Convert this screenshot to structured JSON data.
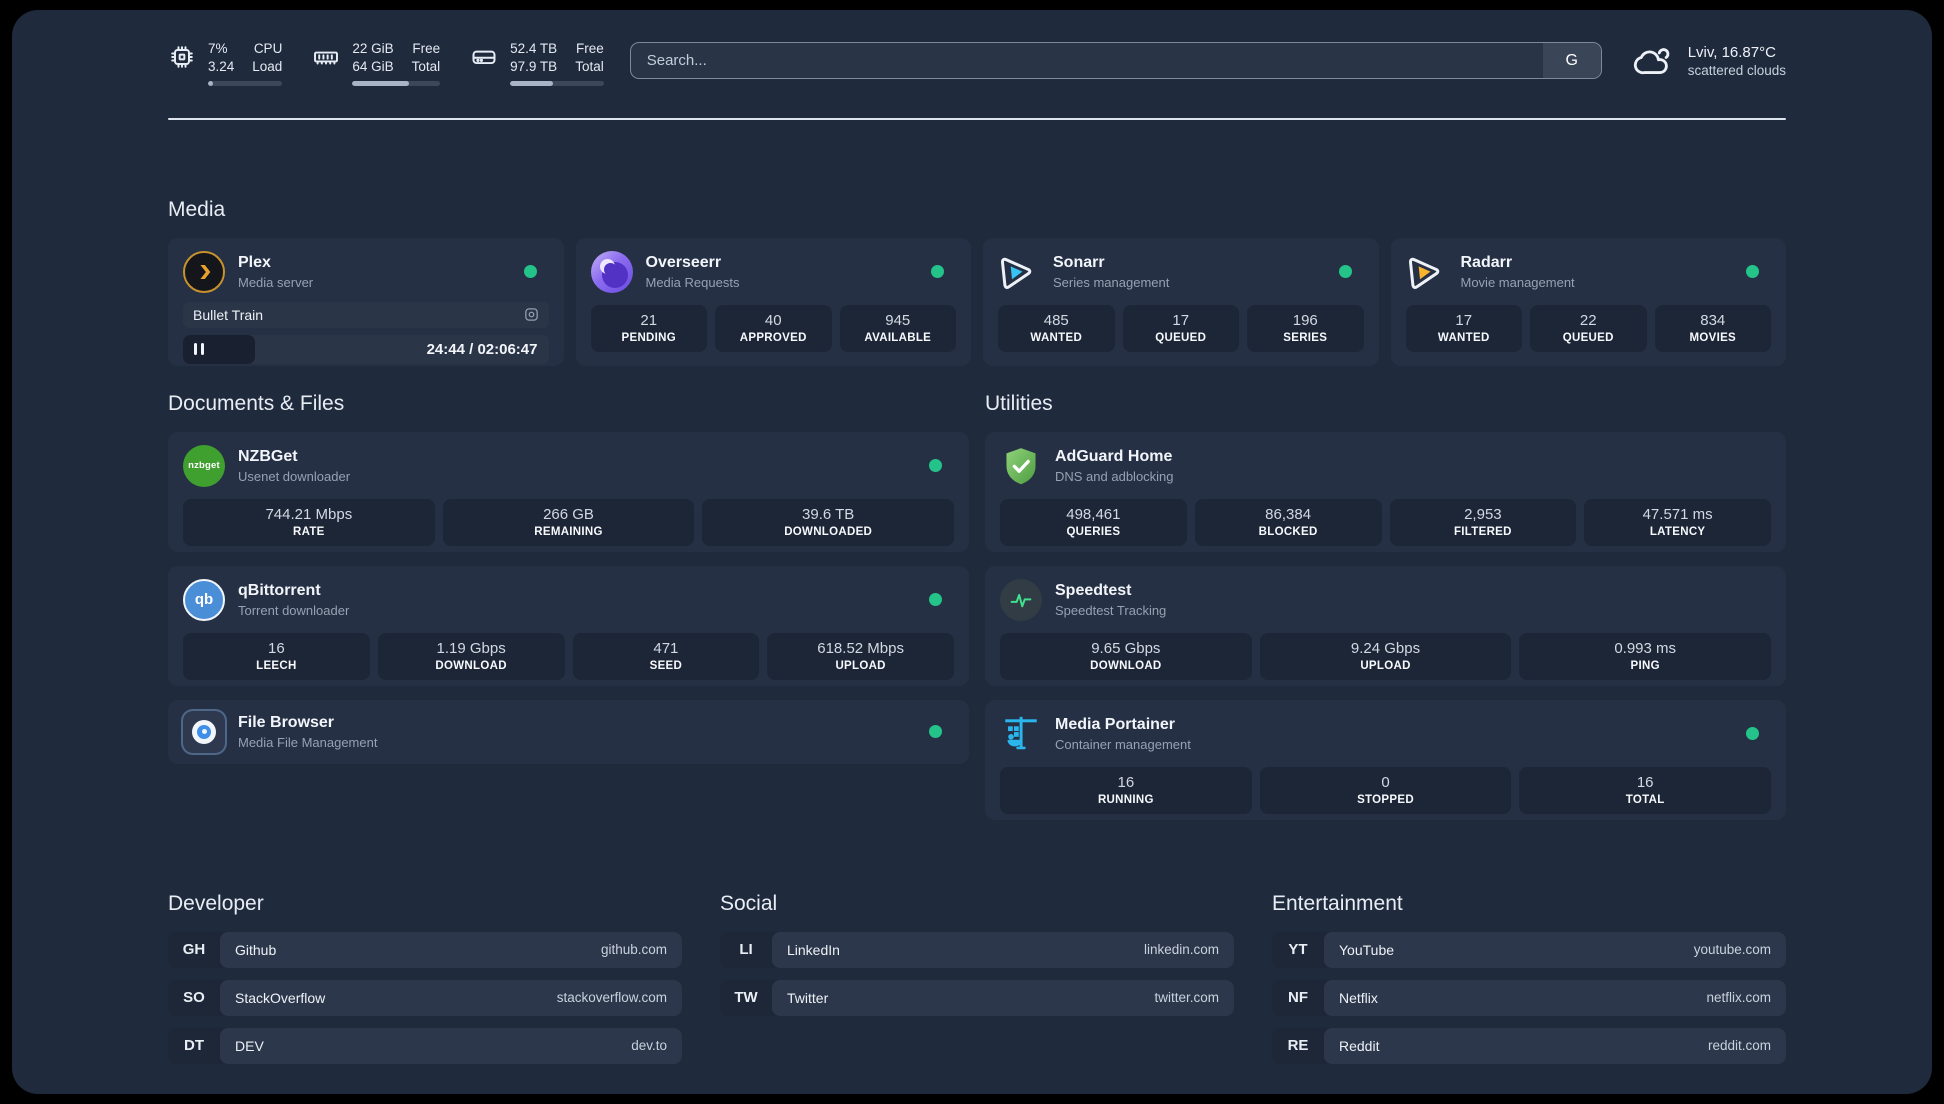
{
  "theme": {
    "status_green": "#23c38a",
    "accent_bar": "#a9b4c4"
  },
  "topbar": {
    "cpu": {
      "values": [
        "7%",
        "3.24"
      ],
      "labels": [
        "CPU",
        "Load"
      ],
      "progress_pct": 7
    },
    "memory": {
      "values": [
        "22 GiB",
        "64 GiB"
      ],
      "labels": [
        "Free",
        "Total"
      ],
      "progress_pct": 65
    },
    "disk": {
      "values": [
        "52.4 TB",
        "97.9 TB"
      ],
      "labels": [
        "Free",
        "Total"
      ],
      "progress_pct": 46
    },
    "search": {
      "placeholder": "Search...",
      "button": "G"
    },
    "weather": {
      "line1": "Lviv, 16.87°C",
      "line2": "scattered clouds"
    }
  },
  "media": {
    "heading": "Media",
    "plex": {
      "name": "Plex",
      "desc": "Media server",
      "session": "Bullet Train",
      "time": "24:44 / 02:06:47",
      "progress_pct": 19.6
    },
    "overseerr": {
      "name": "Overseerr",
      "desc": "Media Requests",
      "stats": [
        {
          "value": "21",
          "label": "PENDING"
        },
        {
          "value": "40",
          "label": "APPROVED"
        },
        {
          "value": "945",
          "label": "AVAILABLE"
        }
      ]
    },
    "sonarr": {
      "name": "Sonarr",
      "desc": "Series management",
      "stats": [
        {
          "value": "485",
          "label": "WANTED"
        },
        {
          "value": "17",
          "label": "QUEUED"
        },
        {
          "value": "196",
          "label": "SERIES"
        }
      ]
    },
    "radarr": {
      "name": "Radarr",
      "desc": "Movie management",
      "stats": [
        {
          "value": "17",
          "label": "WANTED"
        },
        {
          "value": "22",
          "label": "QUEUED"
        },
        {
          "value": "834",
          "label": "MOVIES"
        }
      ]
    }
  },
  "documents": {
    "heading": "Documents & Files",
    "nzbget": {
      "name": "NZBGet",
      "desc": "Usenet downloader",
      "icon_text": "nzbget",
      "stats": [
        {
          "value": "744.21 Mbps",
          "label": "RATE"
        },
        {
          "value": "266 GB",
          "label": "REMAINING"
        },
        {
          "value": "39.6 TB",
          "label": "DOWNLOADED"
        }
      ]
    },
    "qbittorrent": {
      "name": "qBittorrent",
      "desc": "Torrent downloader",
      "icon_text": "qb",
      "stats": [
        {
          "value": "16",
          "label": "LEECH"
        },
        {
          "value": "1.19 Gbps",
          "label": "DOWNLOAD"
        },
        {
          "value": "471",
          "label": "SEED"
        },
        {
          "value": "618.52 Mbps",
          "label": "UPLOAD"
        }
      ]
    },
    "filebrowser": {
      "name": "File Browser",
      "desc": "Media File Management"
    }
  },
  "utilities": {
    "heading": "Utilities",
    "adguard": {
      "name": "AdGuard Home",
      "desc": "DNS and adblocking",
      "stats": [
        {
          "value": "498,461",
          "label": "QUERIES"
        },
        {
          "value": "86,384",
          "label": "BLOCKED"
        },
        {
          "value": "2,953",
          "label": "FILTERED"
        },
        {
          "value": "47.571 ms",
          "label": "LATENCY"
        }
      ]
    },
    "speedtest": {
      "name": "Speedtest",
      "desc": "Speedtest Tracking",
      "stats": [
        {
          "value": "9.65 Gbps",
          "label": "DOWNLOAD"
        },
        {
          "value": "9.24 Gbps",
          "label": "UPLOAD"
        },
        {
          "value": "0.993 ms",
          "label": "PING"
        }
      ]
    },
    "portainer": {
      "name": "Media Portainer",
      "desc": "Container management",
      "stats": [
        {
          "value": "16",
          "label": "RUNNING"
        },
        {
          "value": "0",
          "label": "STOPPED"
        },
        {
          "value": "16",
          "label": "TOTAL"
        }
      ]
    }
  },
  "bookmarks": [
    {
      "heading": "Developer",
      "items": [
        {
          "abbr": "GH",
          "name": "Github",
          "url": "github.com"
        },
        {
          "abbr": "SO",
          "name": "StackOverflow",
          "url": "stackoverflow.com"
        },
        {
          "abbr": "DT",
          "name": "DEV",
          "url": "dev.to"
        }
      ]
    },
    {
      "heading": "Social",
      "items": [
        {
          "abbr": "LI",
          "name": "LinkedIn",
          "url": "linkedin.com"
        },
        {
          "abbr": "TW",
          "name": "Twitter",
          "url": "twitter.com"
        }
      ]
    },
    {
      "heading": "Entertainment",
      "items": [
        {
          "abbr": "YT",
          "name": "YouTube",
          "url": "youtube.com"
        },
        {
          "abbr": "NF",
          "name": "Netflix",
          "url": "netflix.com"
        },
        {
          "abbr": "RE",
          "name": "Reddit",
          "url": "reddit.com"
        }
      ]
    }
  ]
}
